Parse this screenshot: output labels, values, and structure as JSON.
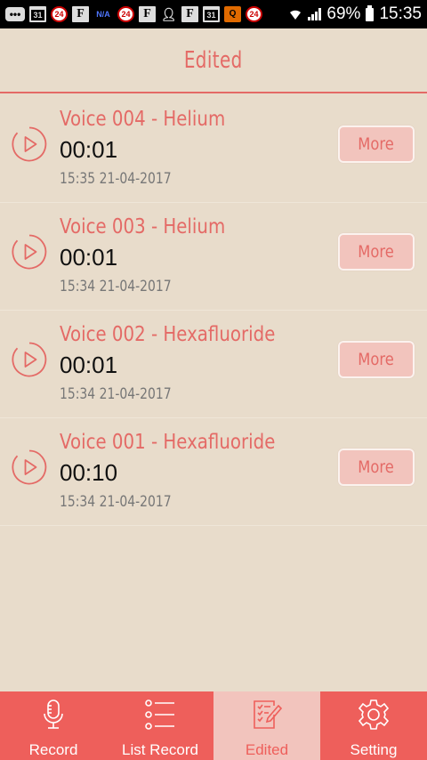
{
  "status_bar": {
    "icons": [
      "chat-icon",
      "calendar-icon",
      "news-24-icon",
      "facebook-icon",
      "na-icon",
      "news-24-icon",
      "facebook-icon",
      "person-icon",
      "facebook-icon",
      "calendar-icon",
      "q-app-icon",
      "news-24-icon"
    ],
    "calendar_day": "31",
    "badge_24": "24",
    "na": "N/A",
    "f": "F",
    "battery": "69%",
    "time": "15:35"
  },
  "header": {
    "title": "Edited"
  },
  "recordings": [
    {
      "title": "Voice 004 - Helium",
      "duration": "00:01",
      "date": "15:35 21-04-2017",
      "more_label": "More"
    },
    {
      "title": "Voice 003 - Helium",
      "duration": "00:01",
      "date": "15:34 21-04-2017",
      "more_label": "More"
    },
    {
      "title": "Voice 002 - Hexafluoride",
      "duration": "00:01",
      "date": "15:34 21-04-2017",
      "more_label": "More"
    },
    {
      "title": "Voice 001 - Hexafluoride",
      "duration": "00:10",
      "date": "15:34 21-04-2017",
      "more_label": "More"
    }
  ],
  "nav": {
    "items": [
      {
        "label": "Record",
        "icon": "microphone-icon",
        "active": false
      },
      {
        "label": "List Record",
        "icon": "list-icon",
        "active": false
      },
      {
        "label": "Edited",
        "icon": "edit-document-icon",
        "active": true
      },
      {
        "label": "Setting",
        "icon": "gear-icon",
        "active": false
      }
    ]
  },
  "colors": {
    "accent": "#e46a66",
    "nav_bg": "#ee5f5b",
    "nav_active_bg": "#f2c4bd",
    "background": "#e8dccb"
  }
}
